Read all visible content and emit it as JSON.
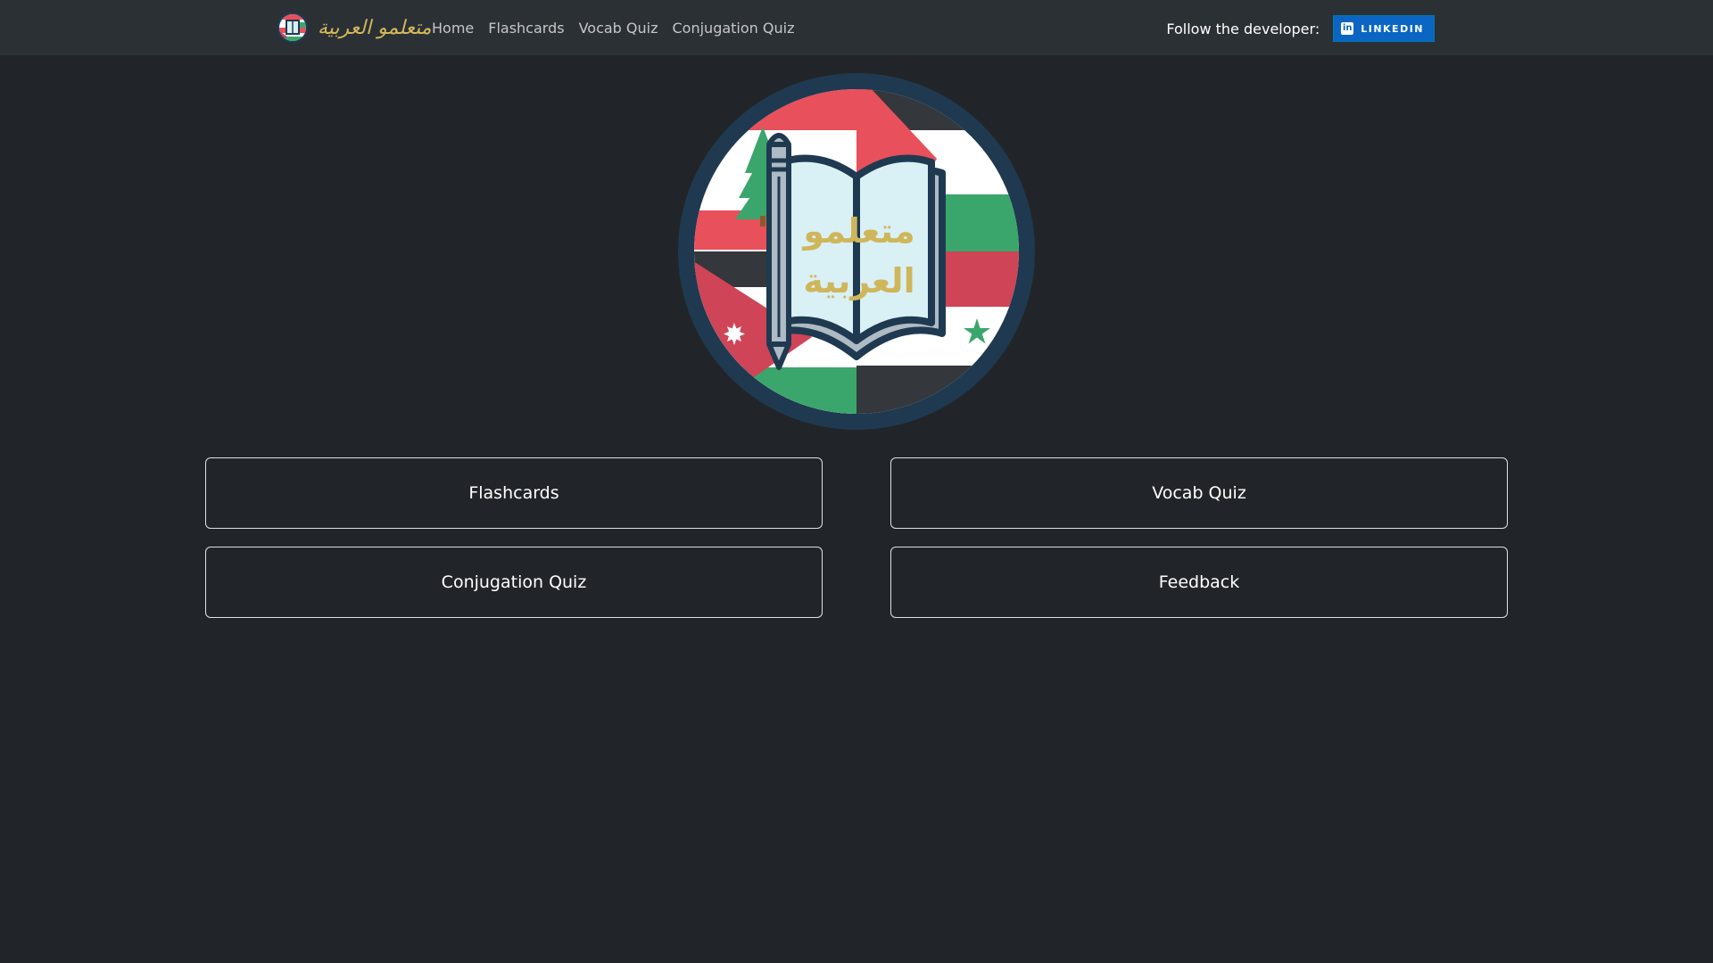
{
  "navbar": {
    "brand_text": "متعلمو العربية",
    "links": [
      {
        "label": "Home"
      },
      {
        "label": "Flashcards"
      },
      {
        "label": "Vocab Quiz"
      },
      {
        "label": "Conjugation Quiz"
      }
    ],
    "follow_label": "Follow the developer:",
    "linkedin_label": "LINKEDIN",
    "linkedin_icon_glyph": "in"
  },
  "logo": {
    "line1": "متعلمو",
    "line2": "العربية"
  },
  "menu": {
    "buttons": [
      {
        "label": "Flashcards"
      },
      {
        "label": "Vocab Quiz"
      },
      {
        "label": "Conjugation Quiz"
      },
      {
        "label": "Feedback"
      }
    ]
  },
  "colors": {
    "page_background": "#212529",
    "navbar_background": "#2b3035",
    "brand_gold": "#d4b85a",
    "linkedin_blue": "#0a66c2",
    "logo_ring": "#1f3a50",
    "flag_red": "#e8505b",
    "flag_green": "#3aa66b",
    "flag_dark": "#34373b"
  },
  "icons": {
    "brand_logo": "app-logo-icon",
    "linkedin": "linkedin-icon",
    "hero": "book-pencil-flags-logo"
  }
}
